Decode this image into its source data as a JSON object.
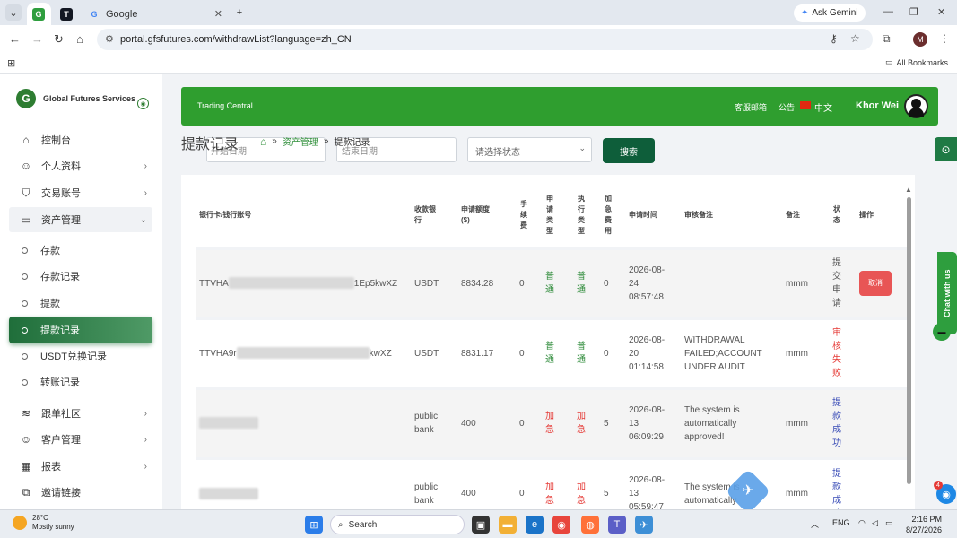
{
  "browser": {
    "tabs": [
      {
        "label": "",
        "icon": "app-icon"
      },
      {
        "label": "",
        "icon": "tradingview-icon"
      },
      {
        "label": "Google",
        "icon": "google-icon"
      }
    ],
    "gemini_label": "Ask Gemini",
    "url": "portal.gfsfutures.com/withdrawList?language=zh_CN",
    "profile_initial": "M",
    "bookmarks_label": "All Bookmarks"
  },
  "sidebar": {
    "logo_mark": "G",
    "brand": "Global Futures Services",
    "items": [
      {
        "label": "控制台",
        "icon": "home-icon",
        "chevron": ""
      },
      {
        "label": "个人资料",
        "icon": "user-icon",
        "chevron": "›"
      },
      {
        "label": "交易账号",
        "icon": "shield-icon",
        "chevron": "›"
      },
      {
        "label": "资产管理",
        "icon": "card-icon",
        "chevron": "⌄"
      }
    ],
    "sub_items": [
      {
        "label": "存款"
      },
      {
        "label": "存款记录"
      },
      {
        "label": "提款"
      },
      {
        "label": "提款记录",
        "active": true
      },
      {
        "label": "USDT兑换记录"
      },
      {
        "label": "转账记录"
      }
    ],
    "items_bottom": [
      {
        "label": "跟单社区",
        "icon": "layers-icon",
        "chevron": "›"
      },
      {
        "label": "客户管理",
        "icon": "add-user-icon",
        "chevron": "›"
      },
      {
        "label": "报表",
        "icon": "table-icon",
        "chevron": "›"
      },
      {
        "label": "邀请链接",
        "icon": "copy-icon",
        "chevron": ""
      }
    ]
  },
  "topbar": {
    "title": "Trading Central",
    "mailbox": "客服邮箱",
    "notice": "公告",
    "language": "中文",
    "username": "Khor Wei"
  },
  "page": {
    "title": "提款记录",
    "breadcrumb": [
      "资产管理",
      "提款记录"
    ],
    "start_date_placeholder": "开始日期",
    "end_date_placeholder": "结束日期",
    "status_placeholder": "请选择状态",
    "search_button": "搜索"
  },
  "table": {
    "headers": [
      "银行卡/钱行账号",
      "收款银行",
      "申请额度($)",
      "手续费",
      "申请类型",
      "执行类型",
      "加急费用",
      "申请时间",
      "审核备注",
      "备注",
      "状态",
      "操作"
    ],
    "rows": [
      {
        "account_start": "TTVHA",
        "account_end": "1Ep5kwXZ",
        "bank": "USDT",
        "amount": "8834.28",
        "fee": "0",
        "apply_type": "普通",
        "exec_type": "普通",
        "urgent_fee": "0",
        "time": "2026-08-24 08:57:48",
        "review": "",
        "remark": "mmm",
        "status": "提交申请",
        "status_color": "#555555",
        "action": "取消"
      },
      {
        "account_start": "TTVHA9r",
        "account_end": "kwXZ",
        "bank": "USDT",
        "amount": "8831.17",
        "fee": "0",
        "apply_type": "普通",
        "exec_type": "普通",
        "urgent_fee": "0",
        "time": "2026-08-20 01:14:58",
        "review": "WITHDRAWAL FAILED;ACCOUNT UNDER AUDIT",
        "remark": "mmm",
        "status": "审核失败",
        "status_color": "#e53935",
        "action": ""
      },
      {
        "account_start": "",
        "account_end": "",
        "bank": "public bank",
        "amount": "400",
        "fee": "0",
        "apply_type": "加急",
        "exec_type": "加急",
        "urgent_fee": "5",
        "time": "2026-08-13 06:09:29",
        "review": "The system is automatically approved!",
        "remark": "mmm",
        "status": "提款成功",
        "status_color": "#3a4db7",
        "action": ""
      },
      {
        "account_start": "",
        "account_end": "",
        "bank": "public bank",
        "amount": "400",
        "fee": "0",
        "apply_type": "加急",
        "exec_type": "加急",
        "urgent_fee": "5",
        "time": "2026-08-13 05:59:47",
        "review": "The system is automatically",
        "remark": "mmm",
        "status": "提款成功",
        "status_color": "#3a4db7",
        "action": ""
      }
    ]
  },
  "widgets": {
    "chat_label": "Chat with us",
    "accessibility_badge": "4"
  },
  "taskbar": {
    "temp": "28°C",
    "weather": "Mostly sunny",
    "search": "Search",
    "lang": "ENG",
    "time": "2:16 PM",
    "date": "8/27/2026"
  }
}
